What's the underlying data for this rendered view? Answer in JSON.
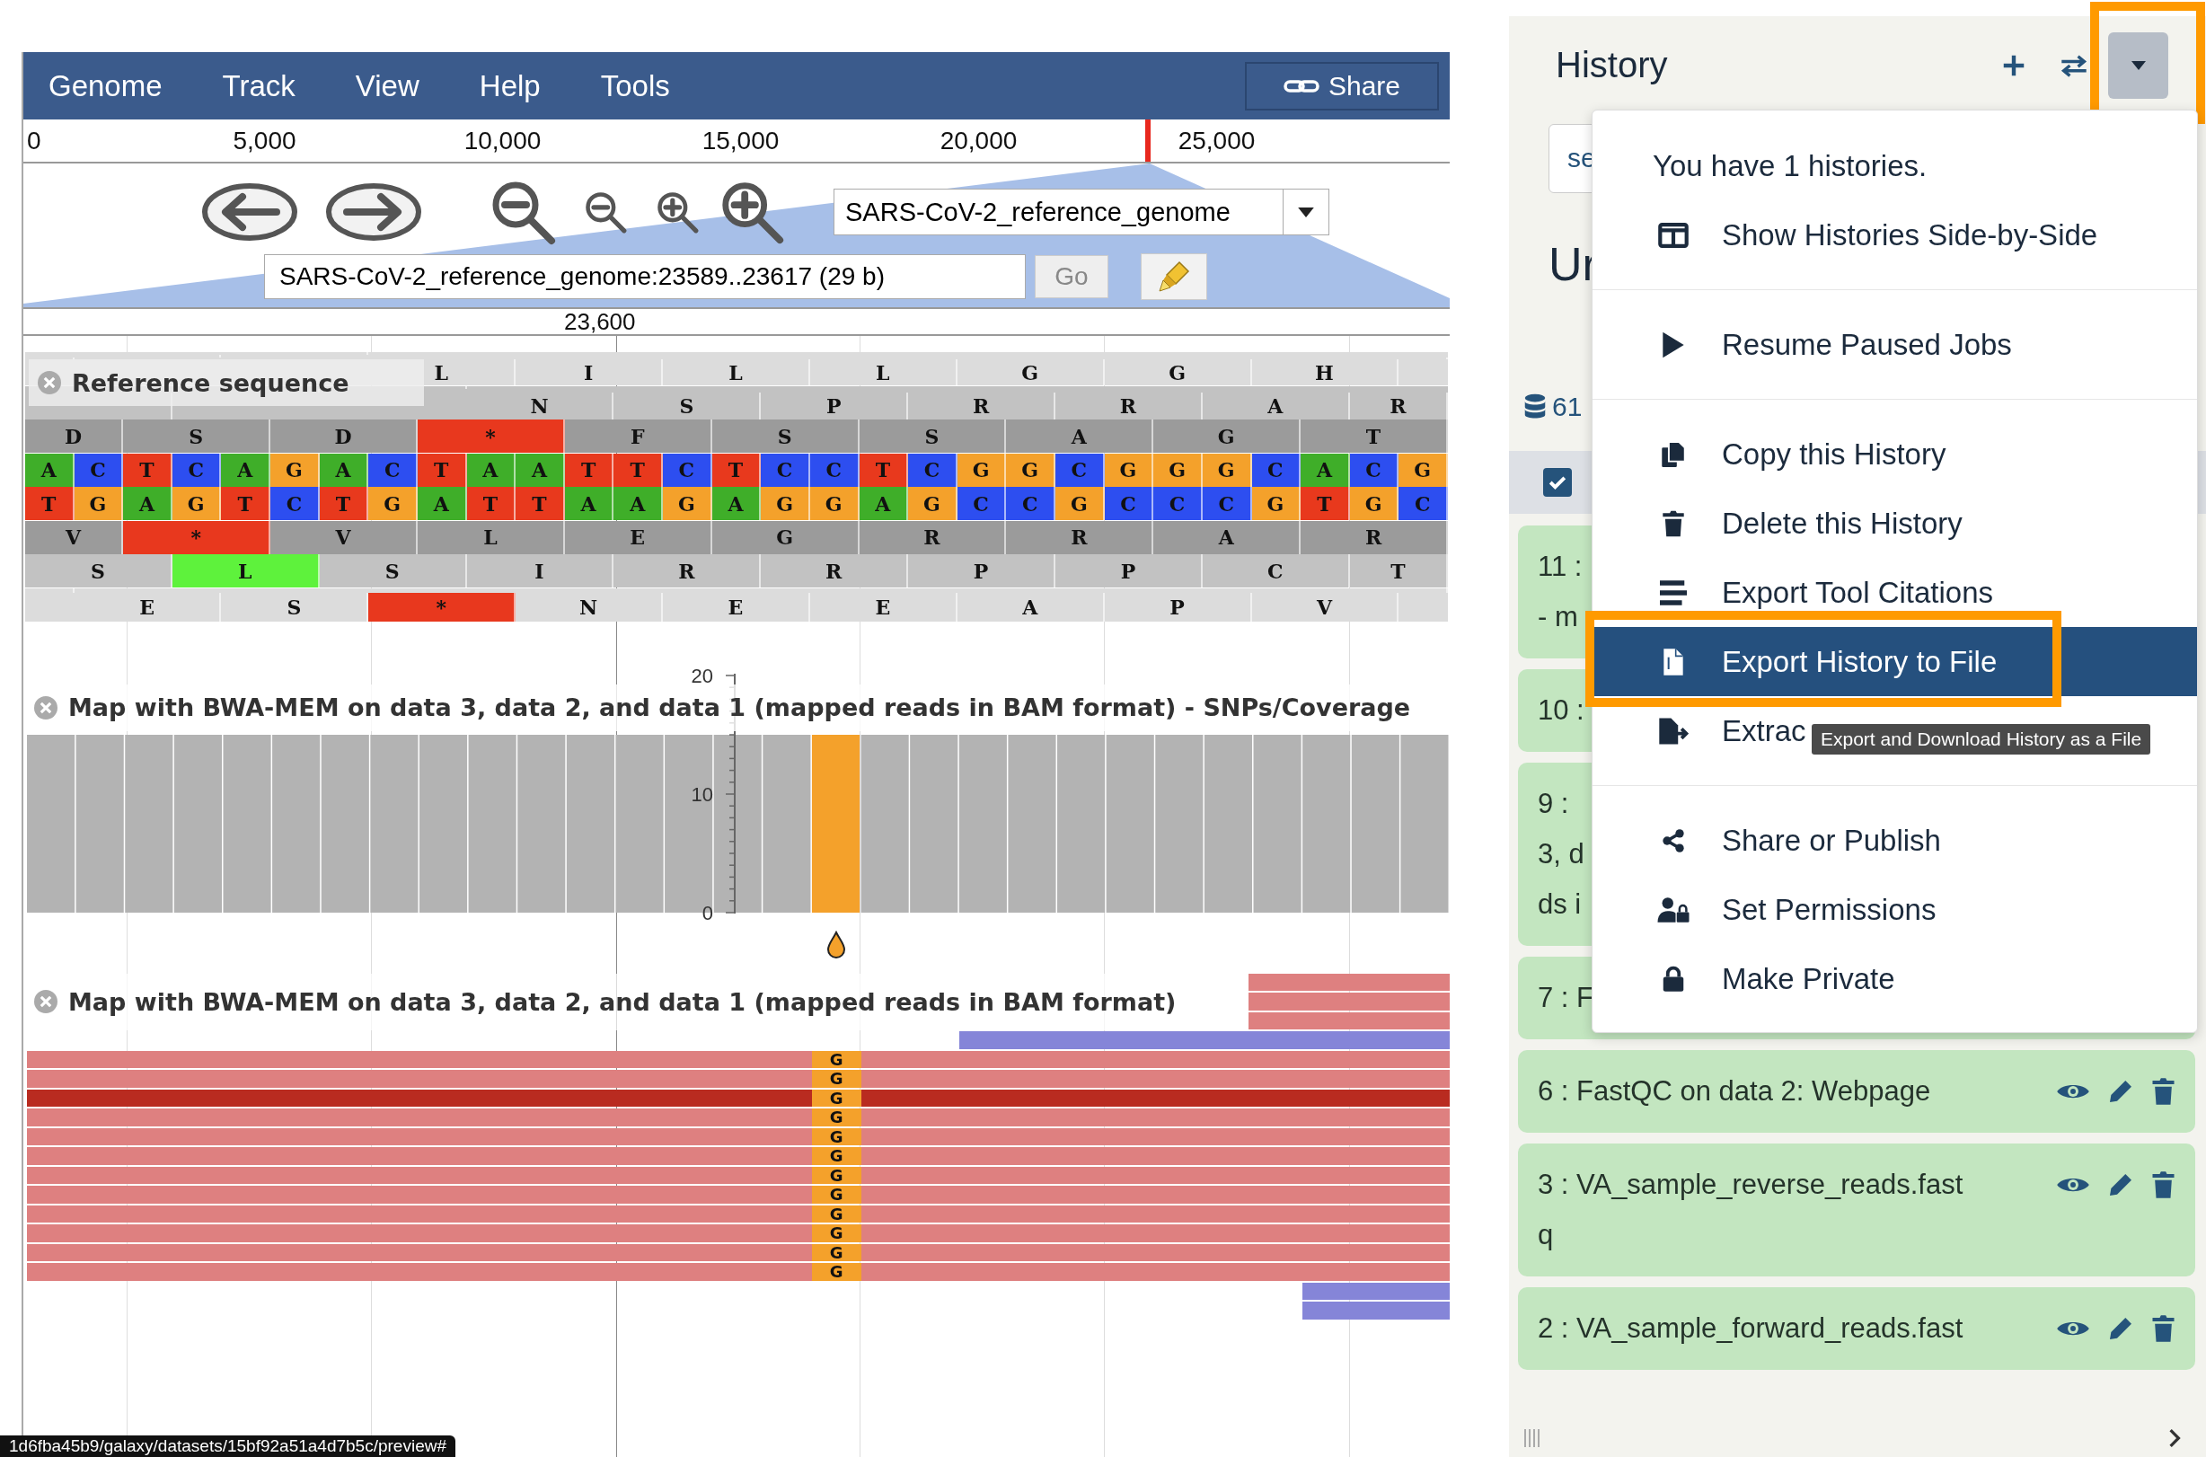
{
  "browser": {
    "menu": [
      "Genome",
      "Track",
      "View",
      "Help",
      "Tools"
    ],
    "share": "Share",
    "ruler": [
      "0",
      "5,000",
      "10,000",
      "15,000",
      "20,000",
      "25,000"
    ],
    "ref_select": "SARS-CoV-2_reference_genome",
    "location": "SARS-CoV-2_reference_genome:23589..23617 (29 b)",
    "go": "Go",
    "scale_label": "23,600",
    "sequence": {
      "label": "Reference sequence",
      "rows": [
        {
          "kind": "frame",
          "residues": [
            {
              "aa": "L"
            },
            {
              "aa": "I"
            },
            {
              "aa": "L"
            },
            {
              "aa": "L"
            },
            {
              "aa": "G"
            },
            {
              "aa": "G"
            },
            {
              "aa": "H"
            }
          ]
        },
        {
          "kind": "frame",
          "residues": [
            {
              "aa": "N"
            },
            {
              "aa": "S"
            },
            {
              "aa": "P"
            },
            {
              "aa": "R"
            },
            {
              "aa": "R"
            },
            {
              "aa": "A"
            },
            {
              "aa": "R"
            }
          ]
        },
        {
          "kind": "frame",
          "residues": [
            {
              "aa": "D"
            },
            {
              "aa": "S"
            },
            {
              "aa": "D"
            },
            {
              "aa": "*",
              "color": "#e8381e"
            },
            {
              "aa": "F"
            },
            {
              "aa": "S"
            },
            {
              "aa": "S"
            },
            {
              "aa": "A"
            },
            {
              "aa": "G"
            },
            {
              "aa": "T"
            }
          ]
        },
        {
          "kind": "bases",
          "bases": [
            {
              "b": "A",
              "color": "#3fae29"
            },
            {
              "b": "C",
              "color": "#2d4ef0"
            },
            {
              "b": "T",
              "color": "#e8391d"
            },
            {
              "b": "C",
              "color": "#2d4ef0"
            },
            {
              "b": "A",
              "color": "#3fae29"
            },
            {
              "b": "G",
              "color": "#f4a12b"
            },
            {
              "b": "A",
              "color": "#3fae29"
            },
            {
              "b": "C",
              "color": "#2d4ef0"
            },
            {
              "b": "T",
              "color": "#e8391d"
            },
            {
              "b": "A",
              "color": "#3fae29"
            },
            {
              "b": "A",
              "color": "#3fae29"
            },
            {
              "b": "T",
              "color": "#e8391d"
            },
            {
              "b": "T",
              "color": "#e8391d"
            },
            {
              "b": "C",
              "color": "#2d4ef0"
            },
            {
              "b": "T",
              "color": "#e8391d"
            },
            {
              "b": "C",
              "color": "#2d4ef0"
            },
            {
              "b": "C",
              "color": "#2d4ef0"
            },
            {
              "b": "T",
              "color": "#e8391d"
            },
            {
              "b": "C",
              "color": "#2d4ef0"
            },
            {
              "b": "G",
              "color": "#f4a12b"
            },
            {
              "b": "G",
              "color": "#f4a12b"
            },
            {
              "b": "C",
              "color": "#2d4ef0"
            },
            {
              "b": "G",
              "color": "#f4a12b"
            },
            {
              "b": "G",
              "color": "#f4a12b"
            },
            {
              "b": "G",
              "color": "#f4a12b"
            },
            {
              "b": "C",
              "color": "#2d4ef0"
            },
            {
              "b": "A",
              "color": "#3fae29"
            },
            {
              "b": "C",
              "color": "#2d4ef0"
            },
            {
              "b": "G",
              "color": "#f4a12b"
            }
          ]
        },
        {
          "kind": "bases",
          "bases": [
            {
              "b": "T",
              "color": "#e8391d"
            },
            {
              "b": "G",
              "color": "#f4a12b"
            },
            {
              "b": "A",
              "color": "#3fae29"
            },
            {
              "b": "G",
              "color": "#f4a12b"
            },
            {
              "b": "T",
              "color": "#e8391d"
            },
            {
              "b": "C",
              "color": "#2d4ef0"
            },
            {
              "b": "T",
              "color": "#e8391d"
            },
            {
              "b": "G",
              "color": "#f4a12b"
            },
            {
              "b": "A",
              "color": "#3fae29"
            },
            {
              "b": "T",
              "color": "#e8391d"
            },
            {
              "b": "T",
              "color": "#e8391d"
            },
            {
              "b": "A",
              "color": "#3fae29"
            },
            {
              "b": "A",
              "color": "#3fae29"
            },
            {
              "b": "G",
              "color": "#f4a12b"
            },
            {
              "b": "A",
              "color": "#3fae29"
            },
            {
              "b": "G",
              "color": "#f4a12b"
            },
            {
              "b": "G",
              "color": "#f4a12b"
            },
            {
              "b": "A",
              "color": "#3fae29"
            },
            {
              "b": "G",
              "color": "#f4a12b"
            },
            {
              "b": "C",
              "color": "#2d4ef0"
            },
            {
              "b": "C",
              "color": "#2d4ef0"
            },
            {
              "b": "G",
              "color": "#f4a12b"
            },
            {
              "b": "C",
              "color": "#2d4ef0"
            },
            {
              "b": "C",
              "color": "#2d4ef0"
            },
            {
              "b": "C",
              "color": "#2d4ef0"
            },
            {
              "b": "G",
              "color": "#f4a12b"
            },
            {
              "b": "T",
              "color": "#e8391d"
            },
            {
              "b": "G",
              "color": "#f4a12b"
            },
            {
              "b": "C",
              "color": "#2d4ef0"
            }
          ]
        },
        {
          "kind": "frame",
          "residues": [
            {
              "aa": "V"
            },
            {
              "aa": "*",
              "color": "#e8381e"
            },
            {
              "aa": "V"
            },
            {
              "aa": "L"
            },
            {
              "aa": "E"
            },
            {
              "aa": "G"
            },
            {
              "aa": "R"
            },
            {
              "aa": "R"
            },
            {
              "aa": "A"
            },
            {
              "aa": "R"
            }
          ]
        },
        {
          "kind": "frame",
          "residues": [
            {
              "aa": "S"
            },
            {
              "aa": "L",
              "color": "#5ef23c"
            },
            {
              "aa": "S"
            },
            {
              "aa": "I"
            },
            {
              "aa": "R"
            },
            {
              "aa": "R"
            },
            {
              "aa": "P"
            },
            {
              "aa": "P"
            },
            {
              "aa": "C"
            },
            {
              "aa": "T"
            }
          ]
        },
        {
          "kind": "frame",
          "residues": [
            {
              "aa": "E"
            },
            {
              "aa": "S"
            },
            {
              "aa": "*",
              "color": "#e8381e"
            },
            {
              "aa": "N"
            },
            {
              "aa": "E"
            },
            {
              "aa": "E"
            },
            {
              "aa": "A"
            },
            {
              "aa": "P"
            },
            {
              "aa": "V"
            }
          ]
        }
      ]
    },
    "coverage": {
      "label": "Map with BWA-MEM on data 3, data 2, and data 1 (mapped reads in BAM format) - SNPs/Coverage",
      "chart_data": {
        "type": "bar",
        "categories": [
          null,
          null,
          null,
          null,
          null,
          null,
          null,
          null,
          null,
          null,
          null,
          null,
          null,
          null,
          null,
          null,
          null,
          null,
          null,
          null,
          null,
          null,
          null,
          null,
          null,
          null,
          null,
          null,
          null
        ],
        "ylim": [
          0,
          20
        ],
        "yticks": [
          0,
          10,
          20
        ],
        "stacked": true,
        "series": [
          {
            "color": "#b3b3b3",
            "values": [
              15,
              15,
              15,
              15,
              15,
              15,
              15,
              15,
              15,
              15,
              15,
              15,
              15,
              15,
              15,
              15,
              0,
              15,
              15,
              15,
              15,
              15,
              15,
              15,
              15,
              15,
              15,
              15,
              15
            ]
          },
          {
            "color": "#f4a12b",
            "values": [
              0,
              0,
              0,
              0,
              0,
              0,
              0,
              0,
              0,
              0,
              0,
              0,
              0,
              0,
              0,
              0,
              15,
              0,
              0,
              0,
              0,
              0,
              0,
              0,
              0,
              0,
              0,
              0,
              0
            ]
          }
        ]
      }
    },
    "reads": {
      "label": "Map with BWA-MEM on data 3, data 2, and data 1 (mapped reads in BAM format)",
      "rows": [
        {
          "kind": "tail"
        },
        {
          "kind": "tail"
        },
        {
          "kind": "tail"
        },
        {
          "kind": "reverse-long"
        },
        {
          "kind": "full",
          "mismatch": "G"
        },
        {
          "kind": "full",
          "mismatch": "G"
        },
        {
          "kind": "selected",
          "mismatch": "G"
        },
        {
          "kind": "full",
          "mismatch": "G"
        },
        {
          "kind": "full",
          "mismatch": "G"
        },
        {
          "kind": "full",
          "mismatch": "G"
        },
        {
          "kind": "full",
          "mismatch": "G"
        },
        {
          "kind": "full",
          "mismatch": "G"
        },
        {
          "kind": "full",
          "mismatch": "G"
        },
        {
          "kind": "full",
          "mismatch": "G"
        },
        {
          "kind": "full",
          "mismatch": "G"
        },
        {
          "kind": "full",
          "mismatch": "G"
        },
        {
          "kind": "reverse-short"
        },
        {
          "kind": "reverse-short"
        }
      ]
    },
    "status_url": "1d6fba45b9/galaxy/datasets/15bf92a51a4d7b5c/preview#"
  },
  "history": {
    "title": "History",
    "menu_button": {
      "annotated": true
    },
    "search": {
      "placeholder": "se"
    },
    "name": "Ur",
    "size": "61",
    "select_all": {
      "checked": true
    },
    "items": [
      {
        "lines": [
          "11 :",
          "- m"
        ]
      },
      {
        "lines": [
          "10 :"
        ]
      },
      {
        "lines": [
          "9 :",
          "3, d",
          "ds i"
        ]
      },
      {
        "lines": [
          "7 : F"
        ]
      },
      {
        "lines": [
          "6 : FastQC on data 2: Webpage"
        ],
        "actions": true
      },
      {
        "lines": [
          "3 : VA_sample_reverse_reads.fast",
          "q"
        ],
        "actions": true
      },
      {
        "lines": [
          "2 : VA_sample_forward_reads.fast"
        ],
        "actions": true
      }
    ],
    "dropdown": {
      "tooltip": "Export and Download History as a File",
      "items": [
        {
          "kind": "header",
          "label": "You have 1 histories."
        },
        {
          "kind": "side-by-side",
          "label": "Show Histories Side-by-Side",
          "selected": false
        },
        {
          "kind": "divider"
        },
        {
          "kind": "resume",
          "label": "Resume Paused Jobs",
          "selected": false
        },
        {
          "kind": "divider"
        },
        {
          "kind": "copy",
          "label": "Copy this History",
          "selected": false
        },
        {
          "kind": "delete",
          "label": "Delete this History",
          "selected": false
        },
        {
          "kind": "citations",
          "label": "Export Tool Citations",
          "selected": false
        },
        {
          "kind": "export",
          "label": "Export History to File",
          "selected": true,
          "annotated": true
        },
        {
          "kind": "extract",
          "label": "Extrac",
          "selected": false
        },
        {
          "kind": "divider"
        },
        {
          "kind": "share",
          "label": "Share or Publish",
          "selected": false
        },
        {
          "kind": "permissions",
          "label": "Set Permissions",
          "selected": false
        },
        {
          "kind": "private",
          "label": "Make Private",
          "selected": false
        }
      ]
    }
  }
}
